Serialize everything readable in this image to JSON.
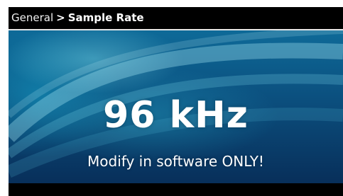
{
  "header": {
    "breadcrumb_root": "General",
    "breadcrumb_separator": ">",
    "breadcrumb_current": "Sample Rate"
  },
  "main": {
    "value": "96 kHz",
    "message": "Modify in software ONLY!"
  },
  "colors": {
    "background_deep": "#082f5a",
    "background_light": "#0e6a98",
    "text": "#ffffff",
    "bars": "#000000"
  }
}
